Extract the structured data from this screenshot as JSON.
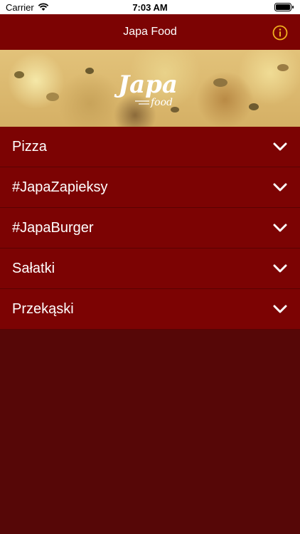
{
  "status_bar": {
    "carrier": "Carrier",
    "time": "7:03 AM"
  },
  "nav": {
    "title": "Japa Food",
    "info_icon": "info-circle-icon"
  },
  "banner": {
    "logo_main": "Japa",
    "logo_sub": "food"
  },
  "menu": {
    "items": [
      {
        "label": "Pizza"
      },
      {
        "label": "#JapaZapieksy"
      },
      {
        "label": "#JapaBurger"
      },
      {
        "label": "Sałatki"
      },
      {
        "label": "Przekąski"
      }
    ]
  },
  "colors": {
    "background": "#560707",
    "nav_bar": "#7c0303",
    "menu_item": "#7c0303",
    "accent_info": "#f2b01e"
  }
}
